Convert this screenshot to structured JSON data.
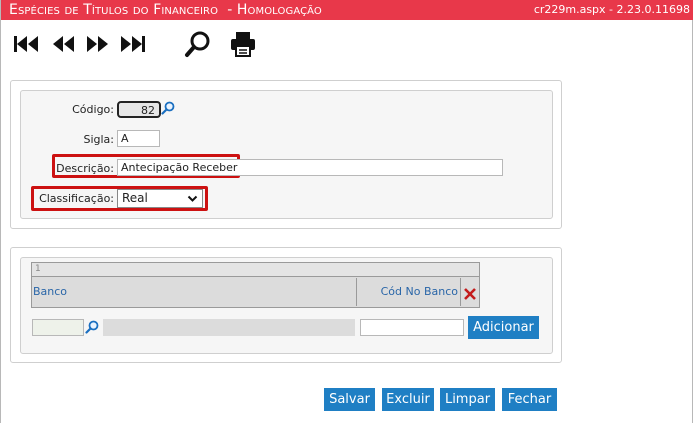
{
  "titlebar": {
    "title_prefix": "Espécies de Títulos do Financeiro",
    "title_env": "- Homologação",
    "program_info": "cr229m.aspx - 2.23.0.11698"
  },
  "form": {
    "codigo_label": "Código:",
    "codigo_value": "82",
    "sigla_label": "Sigla:",
    "sigla_value": "A",
    "descricao_label": "Descrição:",
    "descricao_value": "Antecipação Receber",
    "classificacao_label": "Classificação:",
    "classificacao_value": "Real"
  },
  "grid": {
    "pager_text": "1",
    "col_banco": "Banco",
    "col_cod_no_banco": "Cód No Banco"
  },
  "add_row": {
    "add_button": "Adicionar"
  },
  "actions": {
    "save": "Salvar",
    "delete": "Excluir",
    "clear": "Limpar",
    "close": "Fechar"
  },
  "colors": {
    "titlebar": "#e8384a",
    "button": "#1f7fc4",
    "highlight": "#cc1111",
    "link": "#2a66a8"
  },
  "icons": [
    "first-record-icon",
    "previous-record-icon",
    "next-record-icon",
    "last-record-icon",
    "search-icon",
    "print-icon",
    "lookup-icon",
    "delete-icon"
  ]
}
